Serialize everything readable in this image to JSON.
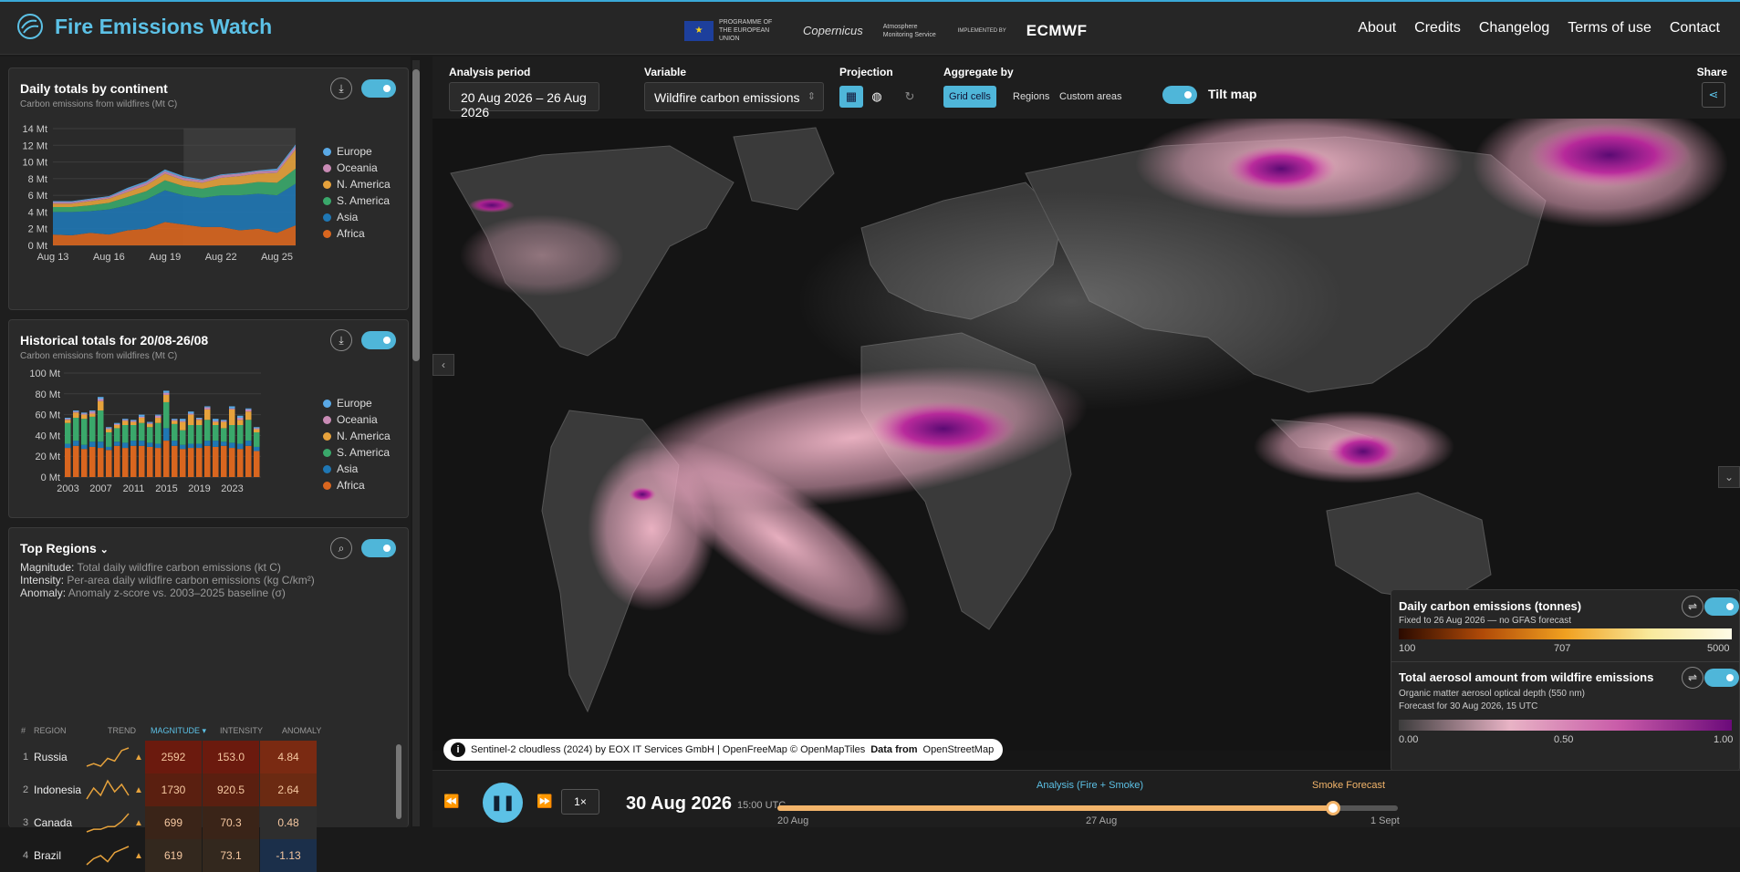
{
  "app": {
    "title": "Fire Emissions Watch"
  },
  "partners": {
    "eu": "PROGRAMME OF THE EUROPEAN UNION",
    "copernicus": "Copernicus",
    "atmosphere": "Atmosphere Monitoring Service",
    "implemented": "IMPLEMENTED BY",
    "ecmwf": "ECMWF"
  },
  "nav": {
    "items": [
      "About",
      "Credits",
      "Changelog",
      "Terms of use",
      "Contact"
    ]
  },
  "colors": {
    "accent": "#5cc1e6",
    "europe": "#5aa9e6",
    "oceania": "#c98bb5",
    "n_america": "#e6a23c",
    "s_america": "#3aa86b",
    "asia": "#1f77b4",
    "africa": "#d9661f"
  },
  "daily_panel": {
    "title": "Daily totals by continent",
    "subtitle": "Carbon emissions from wildfires (Mt C)"
  },
  "hist_panel": {
    "title": "Historical totals for 20/08-26/08",
    "subtitle": "Carbon emissions from wildfires (Mt C)"
  },
  "legend_names": [
    "Europe",
    "Oceania",
    "N. America",
    "S. America",
    "Asia",
    "Africa"
  ],
  "chart_data": [
    {
      "type": "area",
      "title": "Daily totals by continent",
      "subtitle": "Carbon emissions from wildfires (Mt C)",
      "x_tick_labels": [
        "Aug 13",
        "Aug 16",
        "Aug 19",
        "Aug 22",
        "Aug 25"
      ],
      "y_tick_labels": [
        "0 Mt",
        "2 Mt",
        "4 Mt",
        "6 Mt",
        "8 Mt",
        "10 Mt",
        "12 Mt",
        "14 Mt"
      ],
      "ylim": [
        0,
        14
      ],
      "x": [
        "Aug 13",
        "Aug 14",
        "Aug 15",
        "Aug 16",
        "Aug 17",
        "Aug 18",
        "Aug 19",
        "Aug 20",
        "Aug 21",
        "Aug 22",
        "Aug 23",
        "Aug 24",
        "Aug 25",
        "Aug 26"
      ],
      "series": [
        {
          "name": "Africa",
          "values": [
            1.3,
            1.2,
            1.5,
            1.3,
            1.8,
            2.0,
            2.8,
            2.5,
            2.2,
            2.2,
            1.8,
            2.0,
            1.5,
            2.4
          ]
        },
        {
          "name": "Asia",
          "values": [
            2.7,
            2.8,
            2.6,
            3.0,
            3.0,
            3.5,
            3.8,
            3.5,
            3.5,
            3.8,
            4.2,
            4.2,
            4.5,
            5.0
          ]
        },
        {
          "name": "S. America",
          "values": [
            0.6,
            0.6,
            0.7,
            0.8,
            1.0,
            1.0,
            1.2,
            1.1,
            1.1,
            1.2,
            1.3,
            1.4,
            1.5,
            1.8
          ]
        },
        {
          "name": "N. America",
          "values": [
            0.4,
            0.4,
            0.5,
            0.5,
            0.6,
            0.7,
            0.8,
            0.7,
            0.7,
            0.9,
            1.0,
            1.0,
            1.2,
            2.3
          ]
        },
        {
          "name": "Oceania",
          "values": [
            0.2,
            0.2,
            0.2,
            0.2,
            0.3,
            0.3,
            0.3,
            0.3,
            0.3,
            0.3,
            0.3,
            0.3,
            0.3,
            0.4
          ]
        },
        {
          "name": "Europe",
          "values": [
            0.1,
            0.1,
            0.1,
            0.1,
            0.2,
            0.2,
            0.2,
            0.2,
            0.1,
            0.1,
            0.1,
            0.1,
            0.2,
            0.2
          ]
        }
      ],
      "grid": true,
      "legend": "right"
    },
    {
      "type": "bar",
      "title": "Historical totals for 20/08-26/08",
      "subtitle": "Carbon emissions from wildfires (Mt C)",
      "x_tick_labels": [
        "2003",
        "2007",
        "2011",
        "2015",
        "2019",
        "2023"
      ],
      "y_tick_labels": [
        "0 Mt",
        "20 Mt",
        "40 Mt",
        "60 Mt",
        "80 Mt",
        "100 Mt"
      ],
      "ylim": [
        0,
        100
      ],
      "categories": [
        "2003",
        "2004",
        "2005",
        "2006",
        "2007",
        "2008",
        "2009",
        "2010",
        "2011",
        "2012",
        "2013",
        "2014",
        "2015",
        "2016",
        "2017",
        "2018",
        "2019",
        "2020",
        "2021",
        "2022",
        "2023",
        "2024",
        "2025",
        "2026"
      ],
      "series": [
        {
          "name": "Africa",
          "values": [
            28,
            30,
            27,
            29,
            28,
            26,
            30,
            28,
            30,
            30,
            29,
            28,
            35,
            30,
            27,
            28,
            28,
            30,
            29,
            30,
            28,
            27,
            30,
            25
          ]
        },
        {
          "name": "Asia",
          "values": [
            4,
            5,
            4,
            5,
            6,
            3,
            4,
            5,
            5,
            5,
            4,
            4,
            12,
            5,
            4,
            4,
            4,
            5,
            6,
            4,
            5,
            5,
            5,
            4
          ]
        },
        {
          "name": "S. America",
          "values": [
            20,
            22,
            25,
            24,
            30,
            14,
            13,
            17,
            15,
            17,
            15,
            20,
            25,
            16,
            14,
            18,
            18,
            20,
            15,
            13,
            17,
            18,
            20,
            14
          ]
        },
        {
          "name": "N. America",
          "values": [
            3,
            5,
            4,
            3,
            9,
            3,
            3,
            4,
            3,
            5,
            3,
            5,
            7,
            3,
            8,
            10,
            5,
            10,
            3,
            6,
            15,
            5,
            8,
            3
          ]
        },
        {
          "name": "Oceania",
          "values": [
            1,
            1,
            1,
            2,
            2,
            1,
            1,
            1,
            1,
            1,
            1,
            2,
            2,
            1,
            1,
            1,
            1,
            2,
            1,
            1,
            1,
            2,
            2,
            1
          ]
        },
        {
          "name": "Europe",
          "values": [
            1,
            1,
            1,
            1,
            2,
            1,
            1,
            1,
            1,
            2,
            1,
            1,
            2,
            1,
            2,
            2,
            1,
            1,
            2,
            1,
            2,
            2,
            1,
            1
          ]
        }
      ],
      "grid": true,
      "legend": "right"
    }
  ],
  "top_regions": {
    "title": "Top Regions",
    "magnitude_label": "Magnitude:",
    "magnitude_desc": "Total daily wildfire carbon emissions (kt C)",
    "intensity_label": "Intensity:",
    "intensity_desc": "Per-area daily wildfire carbon emissions (kg C/km²)",
    "anomaly_label": "Anomaly:",
    "anomaly_desc": "Anomaly z-score vs. 2003–2025 baseline (σ)",
    "columns": {
      "num": "#",
      "region": "REGION",
      "trend": "TREND",
      "magnitude": "MAGNITUDE ▾",
      "intensity": "INTENSITY",
      "anomaly": "ANOMALY"
    },
    "rows": [
      {
        "rank": "1",
        "region": "Russia",
        "magnitude": "2592",
        "intensity": "153.0",
        "anomaly": "4.84",
        "trend_arrow": "▲",
        "trend": [
          3,
          4,
          3,
          6,
          5,
          9,
          10
        ]
      },
      {
        "rank": "2",
        "region": "Indonesia",
        "magnitude": "1730",
        "intensity": "920.5",
        "anomaly": "2.64",
        "trend_arrow": "▲",
        "trend": [
          4,
          7,
          5,
          9,
          6,
          8,
          5
        ]
      },
      {
        "rank": "3",
        "region": "Canada",
        "magnitude": "699",
        "intensity": "70.3",
        "anomaly": "0.48",
        "trend_arrow": "▲",
        "trend": [
          3,
          4,
          4,
          5,
          5,
          7,
          10
        ]
      },
      {
        "rank": "4",
        "region": "Brazil",
        "magnitude": "619",
        "intensity": "73.1",
        "anomaly": "-1.13",
        "trend_arrow": "▲",
        "trend": [
          3,
          5,
          6,
          4,
          7,
          8,
          9
        ]
      }
    ]
  },
  "controls": {
    "analysis_label": "Analysis period",
    "analysis_value": "20 Aug 2026 – 26 Aug 2026",
    "variable_label": "Variable",
    "variable_value": "Wildfire carbon emissions",
    "projection_label": "Projection",
    "aggregate_label": "Aggregate by",
    "aggregate_options": [
      "Grid cells",
      "Regions",
      "Custom areas"
    ],
    "tilt_label": "Tilt map",
    "share_label": "Share"
  },
  "attribution": {
    "info": "i",
    "text": "Sentinel-2 cloudless (2024) by EOX IT Services GmbH | OpenFreeMap © OpenMapTiles",
    "data_from": "Data from",
    "osm": "OpenStreetMap"
  },
  "map_legend": {
    "emissions_title": "Daily carbon emissions (tonnes)",
    "emissions_sub": "Fixed to 26 Aug 2026 — no GFAS forecast",
    "emissions_ticks": [
      "100",
      "707",
      "5000"
    ],
    "aerosol_title": "Total aerosol amount from wildfire emissions",
    "aerosol_sub1": "Organic matter aerosol optical depth (550 nm)",
    "aerosol_sub2": "Forecast for 30 Aug 2026, 15 UTC",
    "aerosol_ticks": [
      "0.00",
      "0.50",
      "1.00"
    ]
  },
  "timeline": {
    "date": "30 Aug 2026",
    "time": "15:00 UTC",
    "speed": "1×",
    "analysis_label": "Analysis (Fire + Smoke)",
    "forecast_label": "Smoke Forecast",
    "axis": [
      "20 Aug",
      "27 Aug",
      "1 Sept"
    ],
    "progress": 0.895
  }
}
